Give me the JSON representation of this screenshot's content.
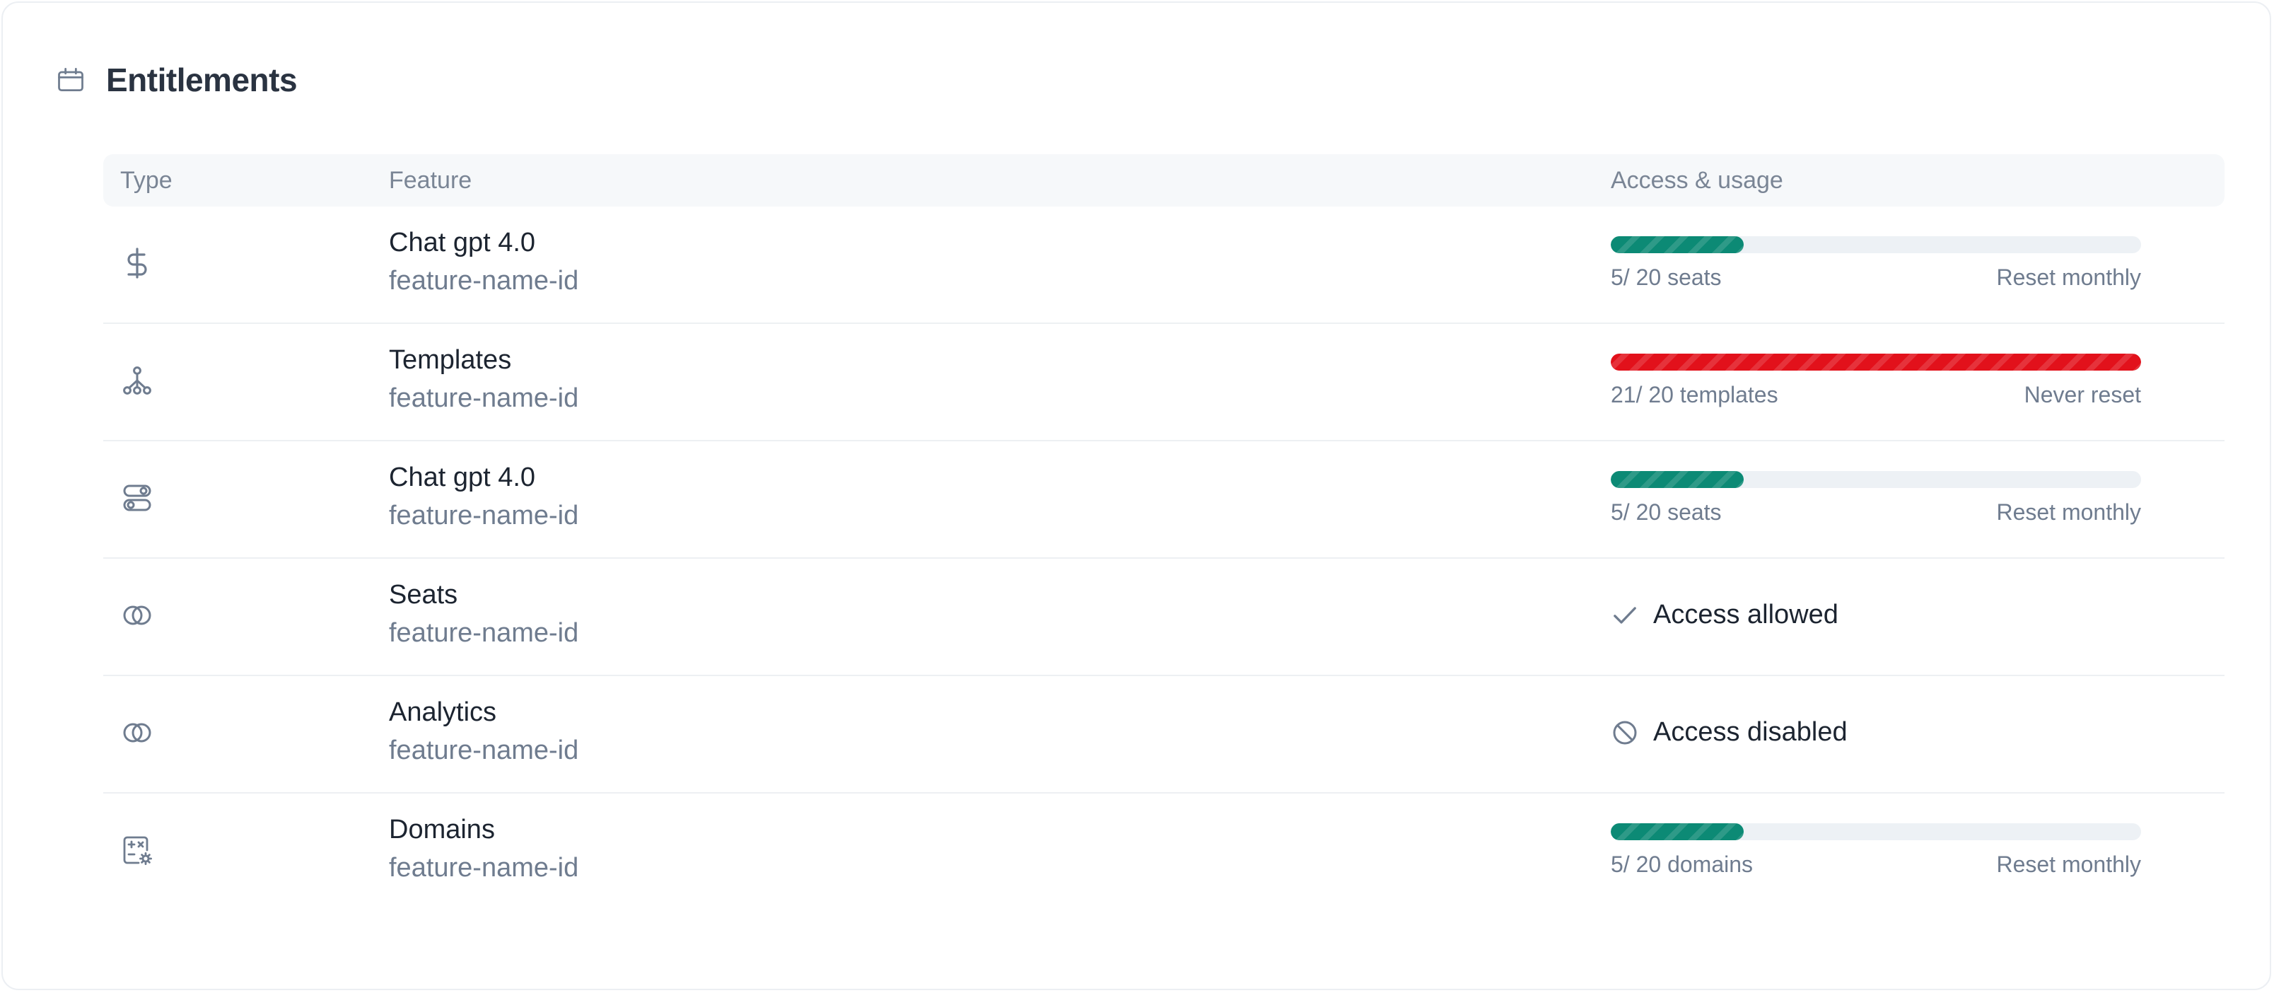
{
  "header": {
    "title": "Entitlements",
    "icon": "calendar-icon"
  },
  "columns": {
    "type": "Type",
    "feature": "Feature",
    "access": "Access & usage"
  },
  "rows": [
    {
      "type_icon": "dollar-icon",
      "name": "Chat gpt 4.0",
      "id": "feature-name-id",
      "mode": "usage",
      "used_label": "5/ 20 seats",
      "reset": "Reset monthly",
      "used": 5,
      "limit": 20,
      "status": "ok"
    },
    {
      "type_icon": "tree-icon",
      "name": "Templates",
      "id": "feature-name-id",
      "mode": "usage",
      "used_label": "21/ 20 templates",
      "reset": "Never reset",
      "used": 21,
      "limit": 20,
      "status": "over"
    },
    {
      "type_icon": "toggle-icon",
      "name": "Chat gpt 4.0",
      "id": "feature-name-id",
      "mode": "usage",
      "used_label": "5/ 20 seats",
      "reset": "Reset monthly",
      "used": 5,
      "limit": 20,
      "status": "ok"
    },
    {
      "type_icon": "rings-icon",
      "name": "Seats",
      "id": "feature-name-id",
      "mode": "access",
      "access_text": "Access allowed",
      "access_icon": "check-icon"
    },
    {
      "type_icon": "rings-icon",
      "name": "Analytics",
      "id": "feature-name-id",
      "mode": "access",
      "access_text": "Access disabled",
      "access_icon": "blocked-icon"
    },
    {
      "type_icon": "calculator-settings-icon",
      "name": "Domains",
      "id": "feature-name-id",
      "mode": "usage",
      "used_label": "5/ 20 domains",
      "reset": "Reset monthly",
      "used": 5,
      "limit": 20,
      "status": "ok"
    }
  ],
  "colors": {
    "ok": "#0c8a75",
    "over": "#e2111b",
    "track": "#edf1f5",
    "muted": "#6f7c8f",
    "text": "#1c2430"
  }
}
